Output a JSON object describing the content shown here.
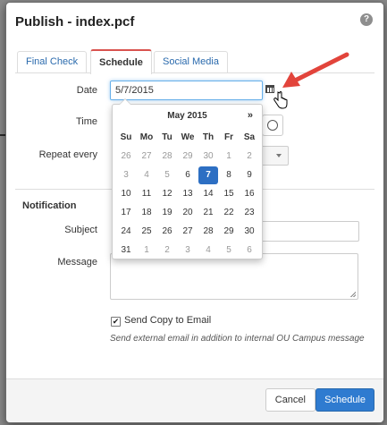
{
  "dialog": {
    "title": "Publish - index.pcf",
    "help_icon": "?"
  },
  "tabs": [
    {
      "label": "Final Check",
      "active": false
    },
    {
      "label": "Schedule",
      "active": true
    },
    {
      "label": "Social Media",
      "active": false
    }
  ],
  "schedule": {
    "date_label": "Date",
    "date_value": "5/7/2015",
    "time_label": "Time",
    "repeat_label": "Repeat every"
  },
  "notification": {
    "section_title": "Notification",
    "subject_label": "Subject",
    "message_label": "Message",
    "send_copy_label": "Send Copy to Email",
    "send_copy_checked": true,
    "checkbox_mark": "✔",
    "help_text": "Send external email in addition to internal OU Campus message"
  },
  "footer": {
    "cancel_label": "Cancel",
    "schedule_label": "Schedule"
  },
  "datepicker": {
    "month_title": "May 2015",
    "next_symbol": "»",
    "weekdays": [
      "Su",
      "Mo",
      "Tu",
      "We",
      "Th",
      "Fr",
      "Sa"
    ],
    "weeks": [
      [
        "26",
        "27",
        "28",
        "29",
        "30",
        "1",
        "2"
      ],
      [
        "3",
        "4",
        "5",
        "6",
        "7",
        "8",
        "9"
      ],
      [
        "10",
        "11",
        "12",
        "13",
        "14",
        "15",
        "16"
      ],
      [
        "17",
        "18",
        "19",
        "20",
        "21",
        "22",
        "23"
      ],
      [
        "24",
        "25",
        "26",
        "27",
        "28",
        "29",
        "30"
      ],
      [
        "31",
        "1",
        "2",
        "3",
        "4",
        "5",
        "6"
      ]
    ],
    "muted_days": [
      [
        0,
        0
      ],
      [
        0,
        1
      ],
      [
        0,
        2
      ],
      [
        0,
        3
      ],
      [
        0,
        4
      ],
      [
        0,
        5
      ],
      [
        0,
        6
      ],
      [
        1,
        0
      ],
      [
        1,
        1
      ],
      [
        1,
        2
      ],
      [
        5,
        1
      ],
      [
        5,
        2
      ],
      [
        5,
        3
      ],
      [
        5,
        4
      ],
      [
        5,
        5
      ],
      [
        5,
        6
      ]
    ],
    "selected_day": [
      1,
      4
    ]
  },
  "colors": {
    "accent": "#2f7bd0",
    "active_tab_border": "#d9534f",
    "annotation_arrow": "#e2443b"
  }
}
